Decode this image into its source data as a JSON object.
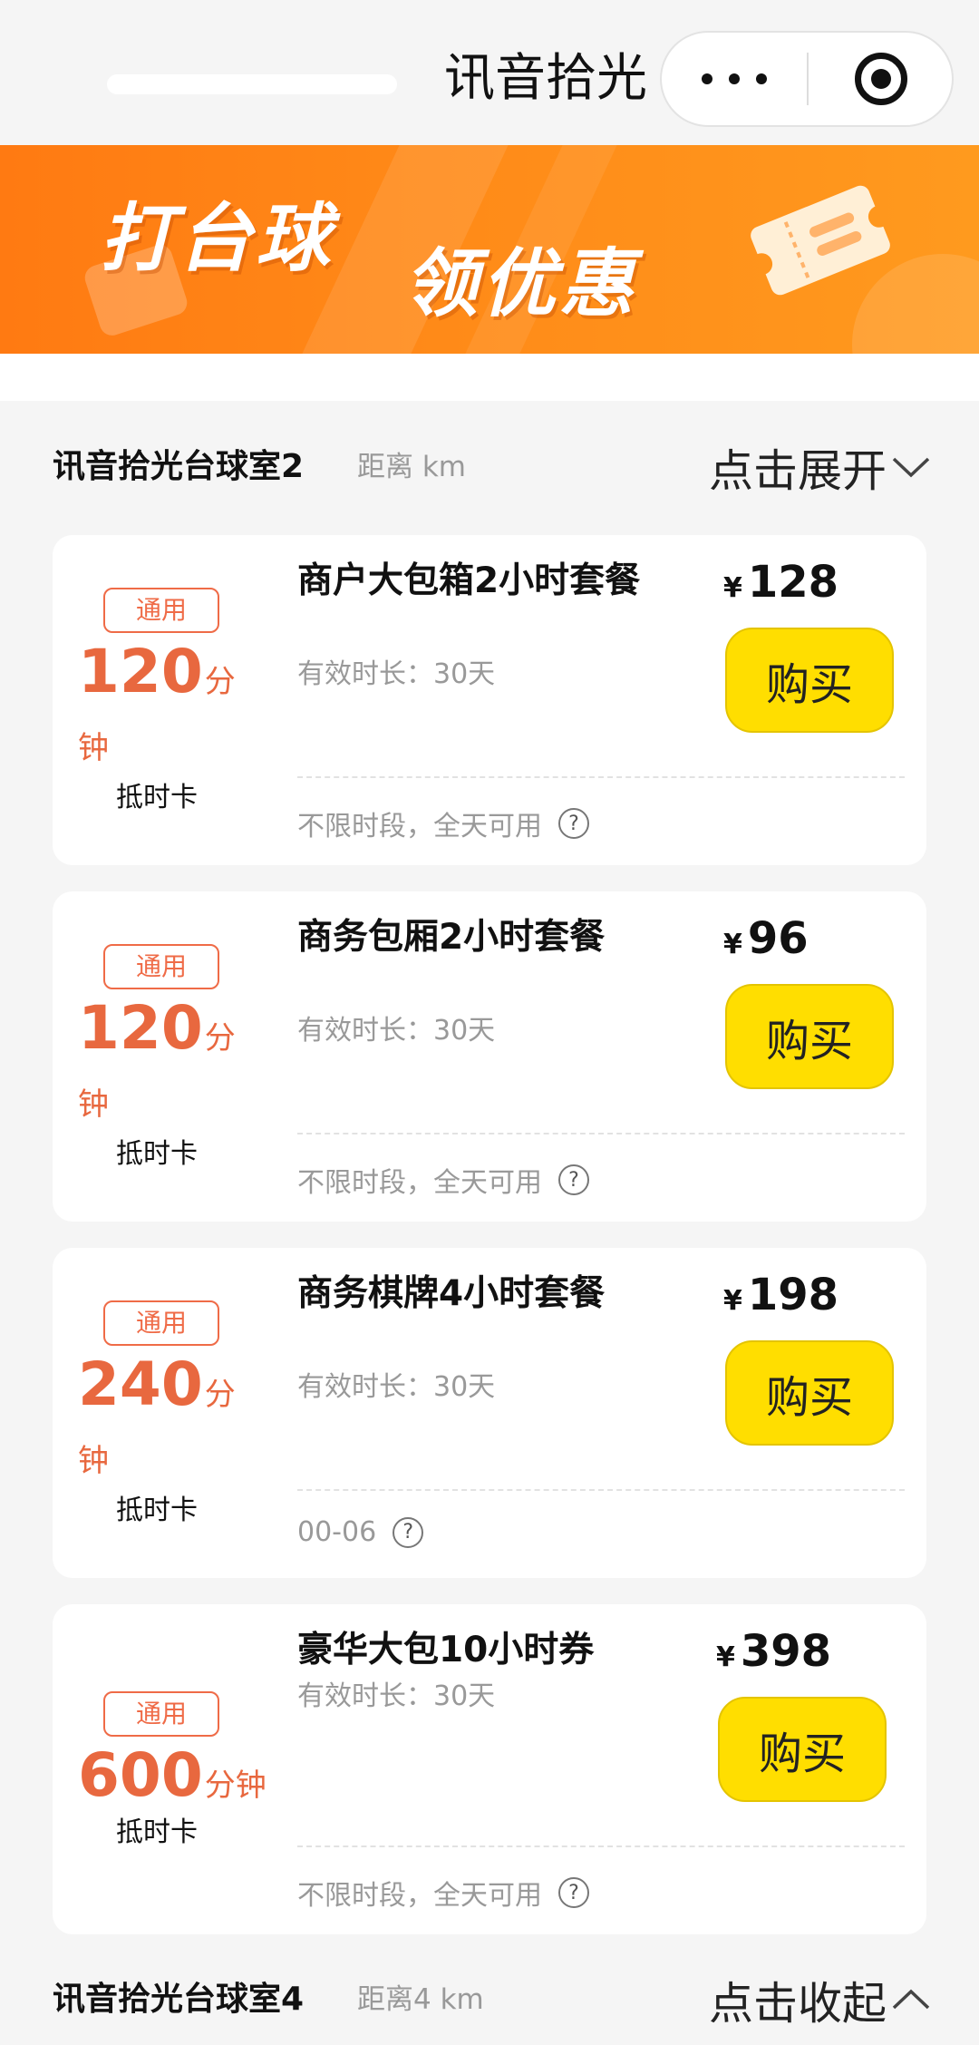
{
  "header": {
    "title": "讯音拾光"
  },
  "banner": {
    "line1": "打台球",
    "line2": "领优惠"
  },
  "sections": [
    {
      "name": "讯音拾光台球室2",
      "distance": "距离 km",
      "toggle": "点击展开"
    },
    {
      "name": "讯音拾光台球室4",
      "distance": "距离4 km",
      "toggle": "点击收起"
    }
  ],
  "cards": [
    {
      "badge": "通用",
      "minutes": "120",
      "unit": "分",
      "unit2": "钟",
      "kind": "抵时卡",
      "name": "商户大包箱2小时套餐",
      "valid": "有效时长：30天",
      "currency": "¥",
      "price": "128",
      "buy": "购买",
      "note": "不限时段，全天可用"
    },
    {
      "badge": "通用",
      "minutes": "120",
      "unit": "分",
      "unit2": "钟",
      "kind": "抵时卡",
      "name": "商务包厢2小时套餐",
      "valid": "有效时长：30天",
      "currency": "¥",
      "price": "96",
      "buy": "购买",
      "note": "不限时段，全天可用"
    },
    {
      "badge": "通用",
      "minutes": "240",
      "unit": "分",
      "unit2": "钟",
      "kind": "抵时卡",
      "name": "商务棋牌4小时套餐",
      "valid": "有效时长：30天",
      "currency": "¥",
      "price": "198",
      "buy": "购买",
      "note": "00-06"
    },
    {
      "badge": "通用",
      "minutes": "600",
      "unit": "分钟",
      "unit2": "",
      "kind": "抵时卡",
      "name": "豪华大包10小时券",
      "valid": "有效时长：30天",
      "currency": "¥",
      "price": "398",
      "buy": "购买",
      "note": "不限时段，全天可用"
    }
  ],
  "colors": {
    "accent": "#e8683f",
    "buy_button": "#ffde00",
    "banner": "#ff8a18"
  },
  "icons": [
    "more-dots-icon",
    "record-icon",
    "ticket-icon",
    "chevron-down-icon",
    "chevron-up-icon",
    "question-icon"
  ]
}
